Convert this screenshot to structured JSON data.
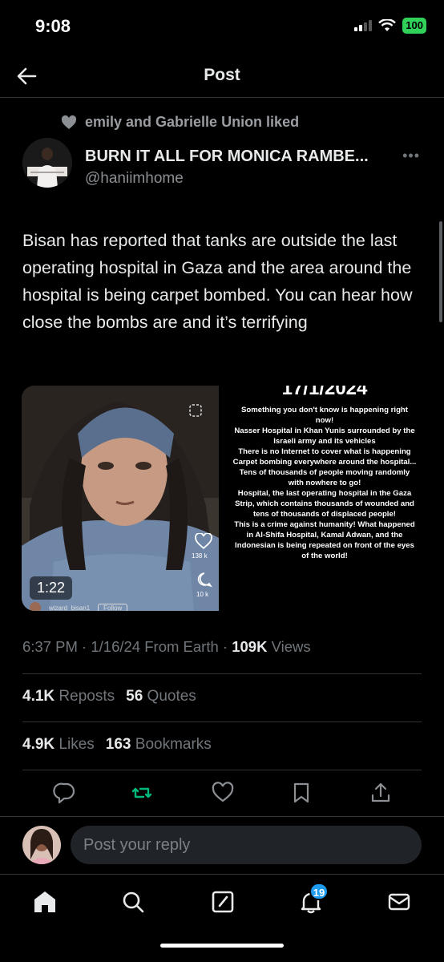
{
  "status_bar": {
    "time": "9:08",
    "battery": "100"
  },
  "header": {
    "title": "Post"
  },
  "social_context": {
    "text": "emily and Gabrielle Union liked"
  },
  "author": {
    "name": "BURN IT ALL FOR MONICA RAMBE...",
    "handle": "@haniimhome"
  },
  "tweet": {
    "text": "Bisan has reported that tanks are outside the last operating hospital in Gaza and the area around the hospital is being carpet bombed. You can hear how close the bombs are and it’s terrifying"
  },
  "media": {
    "duration": "1:22",
    "video_likes": "138 k",
    "video_comments": "10 k",
    "video_username": "wizard_bisan1",
    "video_follow": "Follow",
    "overlay_date": "17/1/2024",
    "overlay_text": [
      "Something you don't know is happening right now!",
      "Nasser Hospital in Khan Yunis surrounded by the Israeli army and its vehicles",
      "There is no Internet to cover what is happening",
      "Carpet bombing everywhere around the hospital... Tens of thousands of people moving randomly with nowhere to go!",
      "Hospital, the last operating hospital in the Gaza Strip, which contains thousands of wounded and tens of thousands of displaced people!",
      "This is a crime against humanity! What happened in Al-Shifa Hospital, Kamal Adwan, and the Indonesian is being repeated on front of the eyes of the world!"
    ]
  },
  "meta": {
    "time": "6:37 PM",
    "date": "1/16/24",
    "source": "From Earth",
    "views_count": "109K",
    "views_label": "Views"
  },
  "stats": {
    "reposts_count": "4.1K",
    "reposts_label": "Reposts",
    "quotes_count": "56",
    "quotes_label": "Quotes",
    "likes_count": "4.9K",
    "likes_label": "Likes",
    "bookmarks_count": "163",
    "bookmarks_label": "Bookmarks"
  },
  "actions": [
    "reply-icon",
    "repost-icon",
    "like-icon",
    "bookmark-icon",
    "share-icon"
  ],
  "reply": {
    "placeholder": "Post your reply"
  },
  "nav": {
    "notifications_badge": "19",
    "items": [
      "home-icon",
      "search-icon",
      "compose-icon",
      "notifications-icon",
      "messages-icon"
    ]
  },
  "colors": {
    "background": "#000000",
    "accent": "#1d9bf0",
    "repost_active": "#00ba7c",
    "battery": "#30d158",
    "text_secondary": "#71767b"
  }
}
